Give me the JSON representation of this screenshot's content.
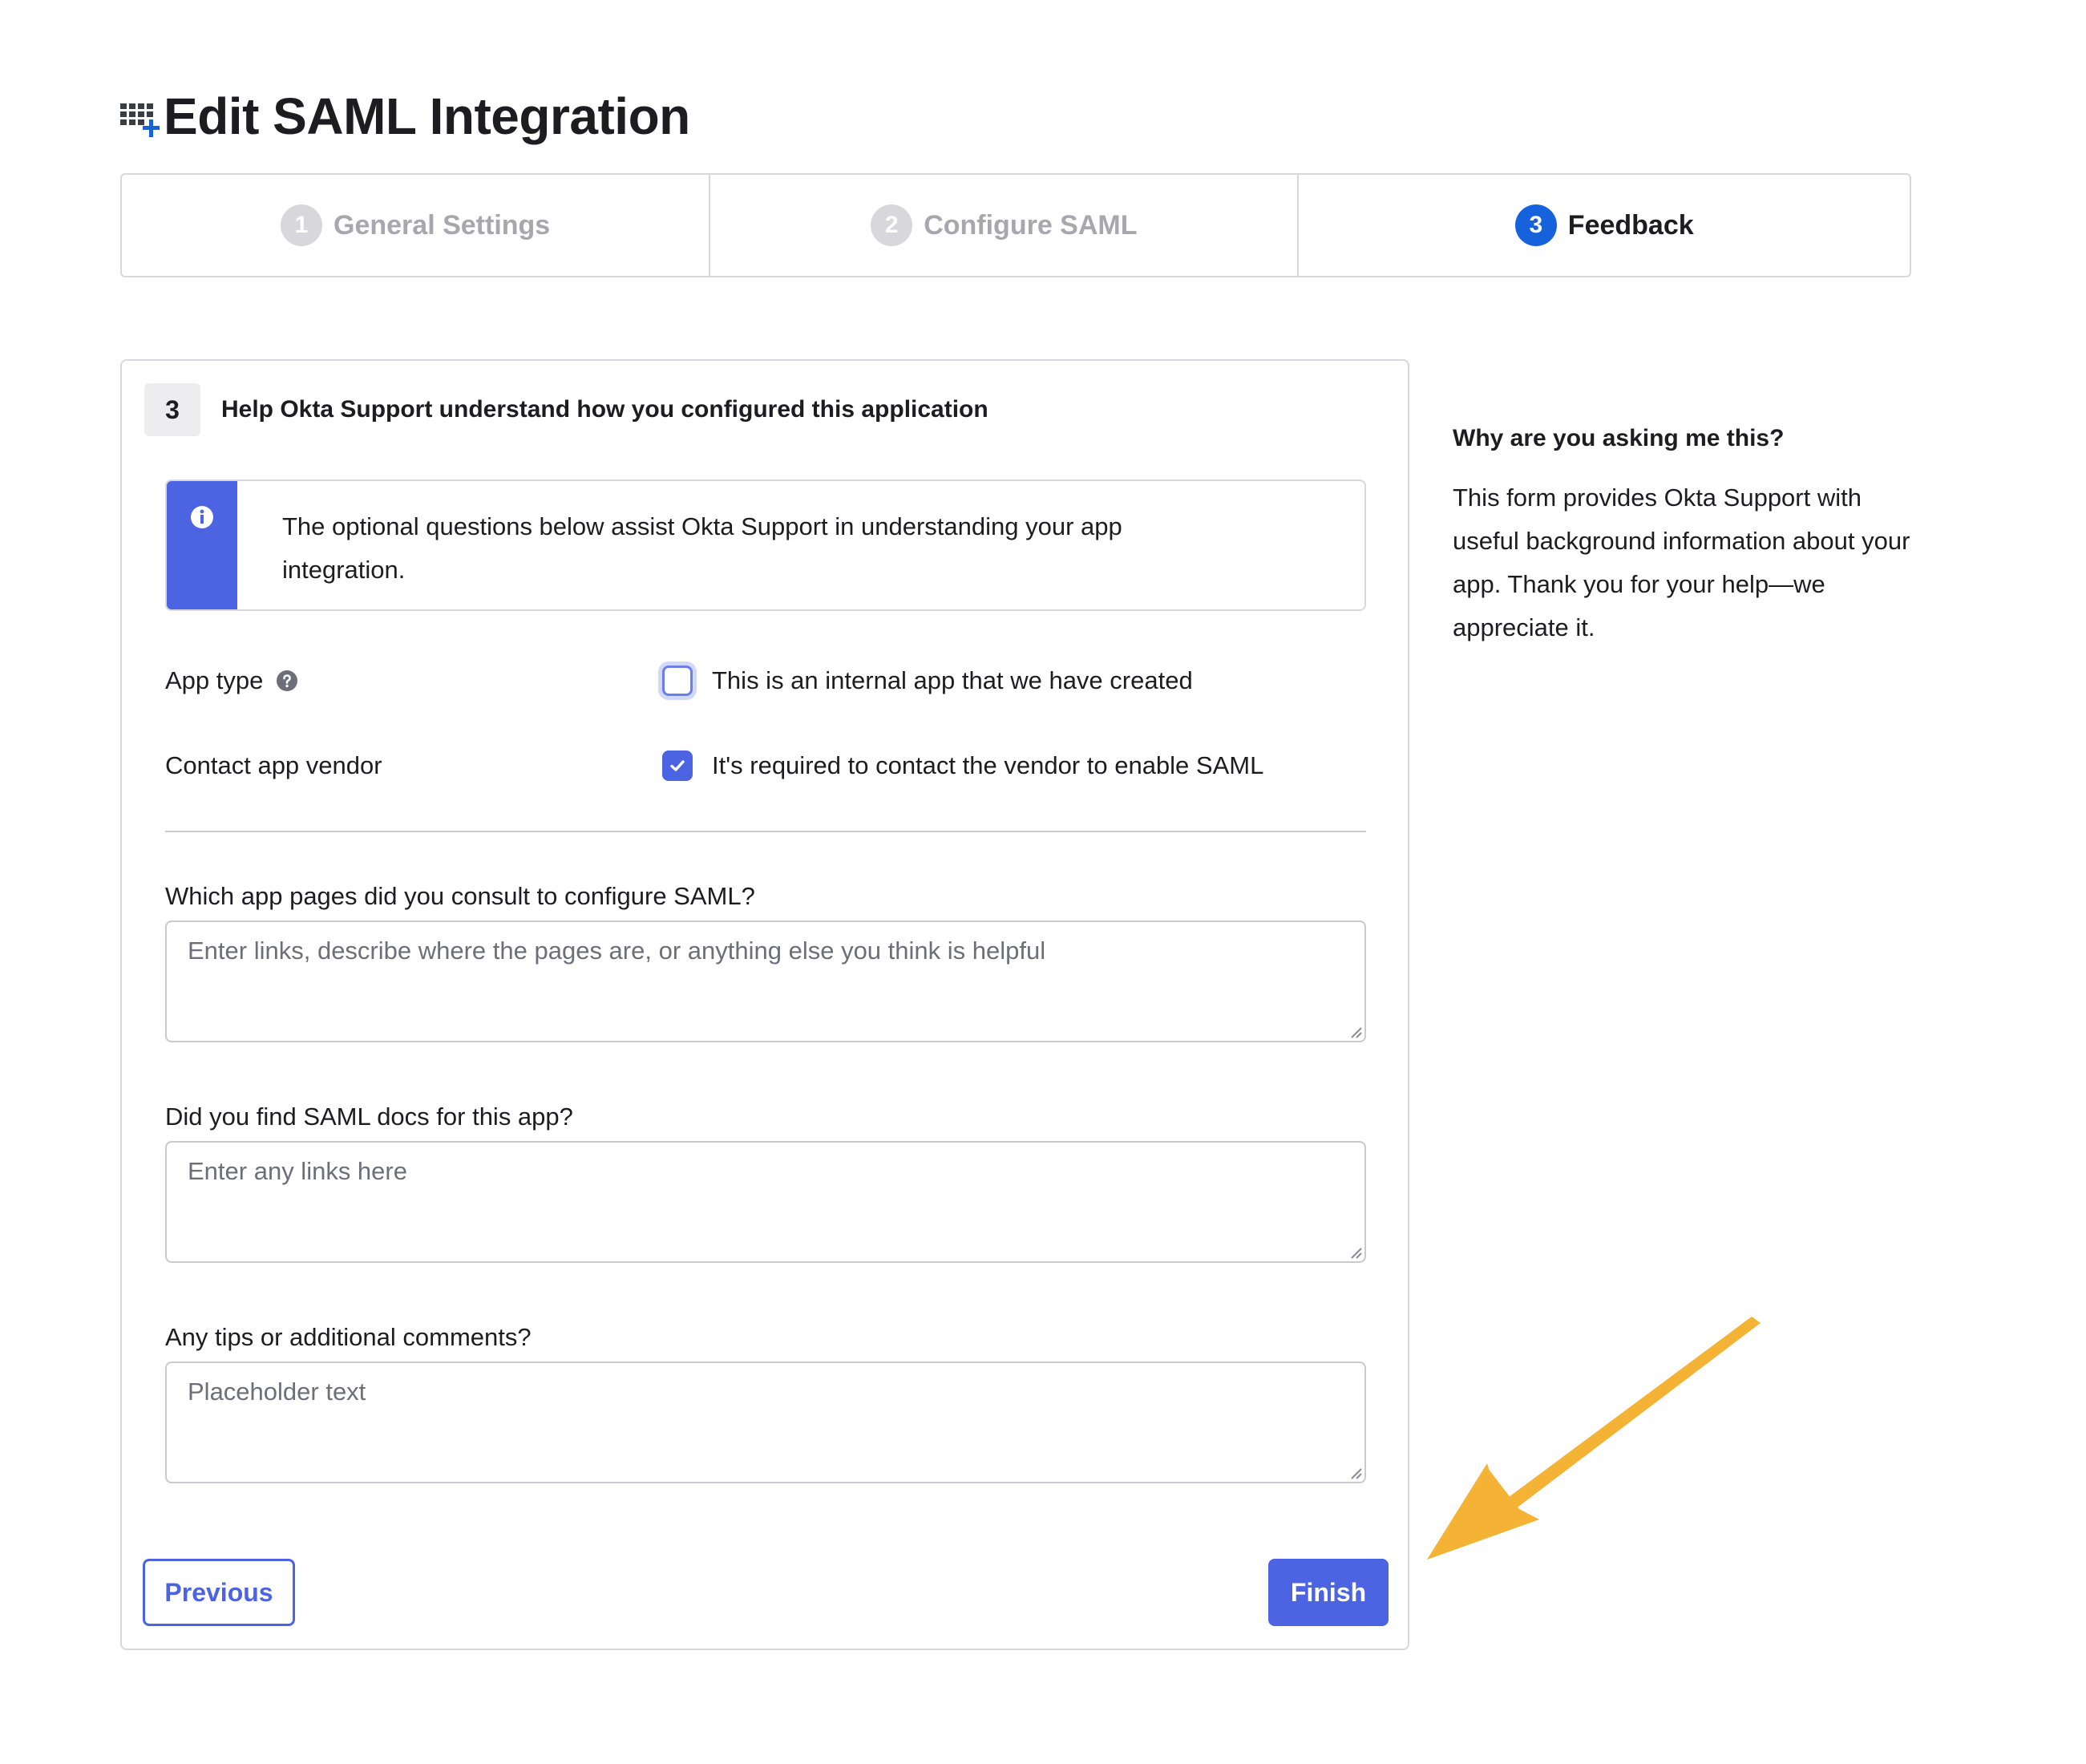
{
  "header": {
    "title": "Edit SAML Integration",
    "icon": "app-grid-plus-icon"
  },
  "stepper": {
    "steps": [
      {
        "number": "1",
        "label": "General Settings",
        "state": "inactive"
      },
      {
        "number": "2",
        "label": "Configure SAML",
        "state": "inactive"
      },
      {
        "number": "3",
        "label": "Feedback",
        "state": "active"
      }
    ]
  },
  "section": {
    "number": "3",
    "title": "Help Okta Support understand how you configured this application"
  },
  "callout": {
    "icon": "info-icon",
    "text": "The optional questions below assist Okta Support in understanding your app integration."
  },
  "fields": {
    "app_type": {
      "label": "App type",
      "checkbox_label": "This is an internal app that we have created",
      "checked": false
    },
    "contact_vendor": {
      "label": "Contact app vendor",
      "checkbox_label": "It's required to contact the vendor to enable SAML",
      "checked": true
    }
  },
  "questions": [
    {
      "label": "Which app pages did you consult to configure SAML?",
      "placeholder": "Enter links, describe where the pages are, or anything else you think is helpful",
      "value": ""
    },
    {
      "label": "Did you find SAML docs for this app?",
      "placeholder": "Enter any links here",
      "value": ""
    },
    {
      "label": "Any tips or additional comments?",
      "placeholder": "Placeholder text",
      "value": ""
    }
  ],
  "buttons": {
    "previous": "Previous",
    "finish": "Finish"
  },
  "side_help": {
    "title": "Why are you asking me this?",
    "body": "This form provides Okta Support with useful background information about your app. Thank you for your help—we appreciate it."
  },
  "colors": {
    "primary": "#4c64e1",
    "step_active": "#1662dd",
    "annotation_arrow": "#f5b335"
  }
}
